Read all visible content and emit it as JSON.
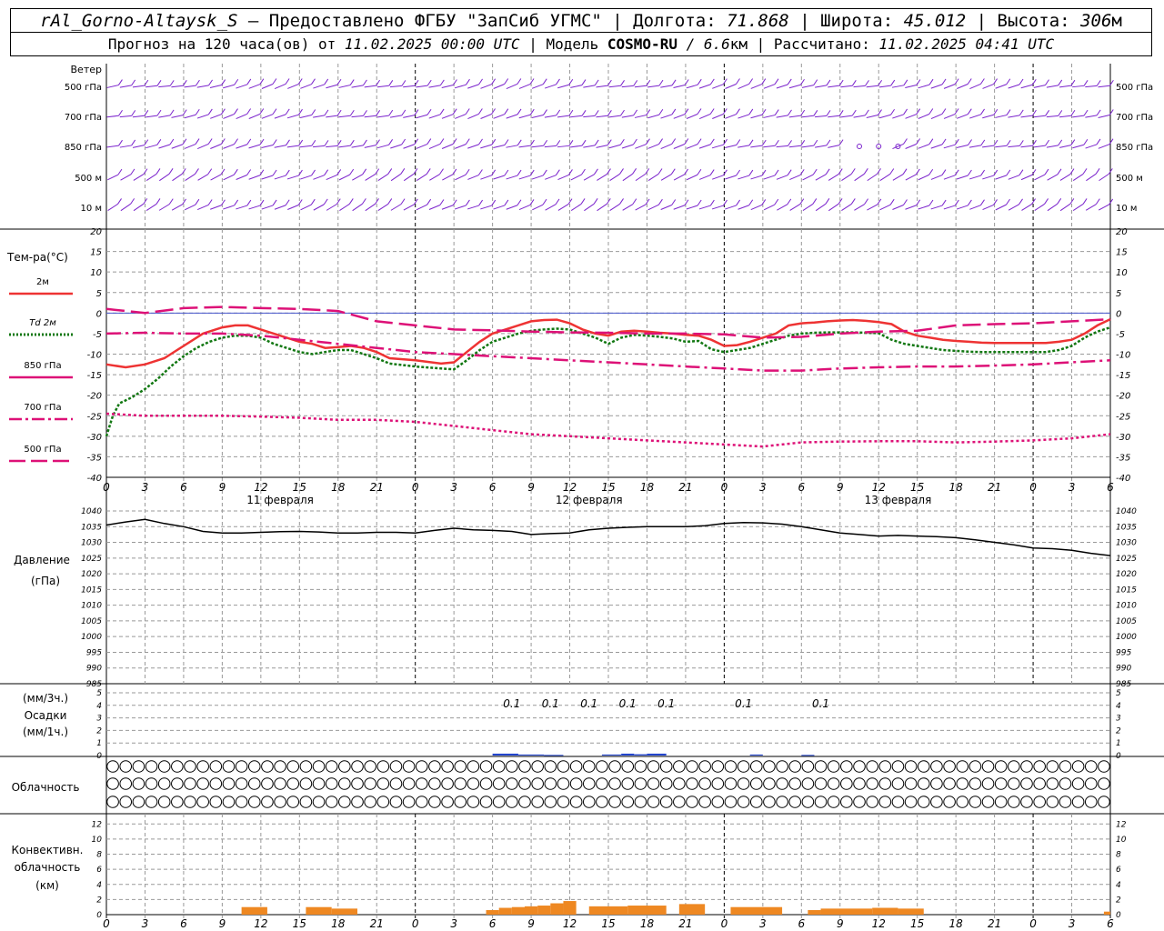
{
  "header": {
    "station": "rAl_Gorno-Altaysk_S",
    "provider": " — Предоставлено ФГБУ \"ЗапСиб УГМС\" | Долгота: ",
    "lon": "71.868",
    "lat_label": " | Широта: ",
    "lat": "45.012",
    "alt_label": " | Высота: ",
    "alt": "306",
    "alt_unit": "м",
    "forecast_label": "Прогноз на 120 часа(ов) от ",
    "forecast_from": "11.02.2025 00:00 UTC",
    "model_label": " | Модель ",
    "model": "COSMO-RU",
    "resolution": " / 6.6",
    "res_unit": "км",
    "calc_label": " | Рассчитано: ",
    "calc_time": "11.02.2025 04:41 UTC"
  },
  "labels": {
    "wind": "Ветер",
    "wind_levels": [
      "500 гПа",
      "700 гПа",
      "850 гПа",
      "500 м",
      "10 м"
    ],
    "temp_title": "Тем-ра(°С)",
    "temp_legend": [
      {
        "label": "2м",
        "color": "#ee3333",
        "style": "solid"
      },
      {
        "label": "Td 2м",
        "color": "#117711",
        "style": "dotted"
      },
      {
        "label": "850 гПа",
        "color": "#dd1177",
        "style": "solid"
      },
      {
        "label": "700 гПа",
        "color": "#dd1177",
        "style": "dashdot"
      },
      {
        "label": "500 гПа",
        "color": "#dd1177",
        "style": "dashed"
      }
    ],
    "pressure_title": "Давление",
    "pressure_unit": "(гПа)",
    "precip_unit3": "(мм/3ч.)",
    "precip_title": "Осадки",
    "precip_unit1": "(мм/1ч.)",
    "cloud_title": "Облачность",
    "conv_title1": "Конвективн.",
    "conv_title2": "облачность",
    "conv_unit": "(км)"
  },
  "colors": {
    "wind": "#7a22cc",
    "t2m": "#ee3333",
    "td2m": "#117711",
    "upper": "#dd1177",
    "zero_line": "#4455cc",
    "pressure": "#000000",
    "precip": "#2244cc",
    "conv": "#ee8822",
    "grid": "#999999"
  },
  "chart_data": {
    "type": "line",
    "x_hours": [
      0,
      3,
      6,
      9,
      12,
      15,
      18,
      21,
      24,
      27,
      30,
      33,
      36,
      39,
      42,
      45,
      48,
      51,
      54,
      57,
      60,
      63,
      66,
      69,
      72,
      75,
      78
    ],
    "x_tick_labels": [
      "0",
      "3",
      "6",
      "9",
      "12",
      "15",
      "18",
      "21",
      "0",
      "3",
      "6",
      "9",
      "12",
      "15",
      "18",
      "21",
      "0",
      "3",
      "6",
      "9",
      "12",
      "15",
      "18",
      "21",
      "0",
      "3",
      "6"
    ],
    "date_labels": [
      {
        "hour": 13.5,
        "text": "11 февраля"
      },
      {
        "hour": 37.5,
        "text": "12 февраля"
      },
      {
        "hour": 61.5,
        "text": "13 февраля"
      }
    ],
    "day_boundaries": [
      24,
      48,
      72
    ],
    "temperature": {
      "ylim": [
        -40,
        20
      ],
      "yticks": [
        20,
        15,
        10,
        5,
        0,
        -5,
        -10,
        -15,
        -20,
        -25,
        -30,
        -35,
        -40
      ],
      "series": [
        {
          "name": "2м",
          "x": [
            0,
            1.5,
            3,
            4.5,
            6,
            7.5,
            9,
            10,
            11,
            12,
            13,
            14,
            15,
            16,
            17,
            18,
            19,
            20,
            21,
            22,
            24,
            26,
            27,
            28,
            29,
            30,
            31,
            32,
            33,
            34,
            35,
            36,
            37,
            38,
            39,
            40,
            41,
            42,
            43,
            44,
            45,
            46,
            47,
            48,
            49,
            50,
            51,
            52,
            53,
            54,
            55,
            56,
            57,
            58,
            59,
            60,
            61,
            62,
            63,
            64,
            65,
            66,
            67,
            68,
            69,
            70,
            71,
            72,
            73,
            74,
            75,
            76,
            77,
            78
          ],
          "y": [
            -12.5,
            -13.2,
            -12.5,
            -11,
            -8,
            -5,
            -3.5,
            -3,
            -3,
            -4,
            -5,
            -6,
            -7,
            -7.5,
            -8.5,
            -8.3,
            -8,
            -8.5,
            -9.5,
            -11,
            -11.5,
            -12.3,
            -12,
            -9.5,
            -7,
            -5,
            -4,
            -3,
            -2,
            -1.7,
            -1.6,
            -2.5,
            -4,
            -5,
            -5.5,
            -4.5,
            -4.3,
            -4.5,
            -4.8,
            -5,
            -5.3,
            -5.5,
            -6.5,
            -8,
            -7.8,
            -7,
            -6,
            -5,
            -3,
            -2.5,
            -2.3,
            -2,
            -1.8,
            -1.7,
            -1.9,
            -2.2,
            -2.7,
            -4.5,
            -5.5,
            -6,
            -6.5,
            -6.8,
            -7,
            -7.2,
            -7.3,
            -7.3,
            -7.3,
            -7.3,
            -7.3,
            -7,
            -6.5,
            -5,
            -3,
            -1.5
          ]
        },
        {
          "name": "Td 2м",
          "x": [
            0,
            0.5,
            1,
            2,
            3,
            4,
            5,
            6,
            7,
            8,
            9,
            10,
            11,
            12,
            13,
            14,
            15,
            16,
            17,
            18,
            19,
            20,
            21,
            22,
            24,
            26,
            27,
            28,
            29,
            30,
            31,
            32,
            33,
            34,
            35,
            36,
            37,
            38,
            39,
            40,
            41,
            42,
            43,
            44,
            45,
            46,
            47,
            48,
            49,
            50,
            51,
            52,
            53,
            54,
            55,
            56,
            57,
            58,
            59,
            60,
            61,
            62,
            63,
            64,
            65,
            66,
            67,
            68,
            69,
            70,
            71,
            72,
            73,
            74,
            75,
            76,
            77,
            78
          ],
          "y": [
            -30,
            -25,
            -22,
            -20.5,
            -18.5,
            -16,
            -13,
            -10.5,
            -8.5,
            -7,
            -6,
            -5.5,
            -5.5,
            -6,
            -7.5,
            -8.5,
            -9.5,
            -10,
            -9.5,
            -9,
            -9,
            -10,
            -11,
            -12.3,
            -13,
            -13.5,
            -13.7,
            -11.5,
            -9,
            -7,
            -6,
            -5,
            -4.3,
            -4,
            -3.8,
            -4,
            -5,
            -6,
            -7.5,
            -6,
            -5.3,
            -5.5,
            -5.8,
            -6.2,
            -7,
            -6.8,
            -8.8,
            -9.5,
            -9,
            -8.5,
            -7.5,
            -6.5,
            -5.5,
            -5,
            -4.8,
            -4.7,
            -4.7,
            -4.7,
            -4.8,
            -4.9,
            -6.5,
            -7.5,
            -8,
            -8.5,
            -9,
            -9.2,
            -9.4,
            -9.5,
            -9.5,
            -9.5,
            -9.5,
            -9.5,
            -9.5,
            -9,
            -8,
            -6,
            -4.5,
            -3.5
          ]
        },
        {
          "name": "850 гПа",
          "x": [
            0,
            3,
            6,
            9,
            12,
            15,
            18,
            21,
            24,
            27,
            30,
            33,
            36,
            39,
            42,
            45,
            48,
            51,
            54,
            57,
            60,
            63,
            66,
            69,
            72,
            75,
            78
          ],
          "y": [
            1,
            0,
            1.2,
            1.5,
            1.2,
            1,
            0.5,
            -2,
            -3,
            -4,
            -4.2,
            -4.5,
            -4.7,
            -4.8,
            -5,
            -5,
            -5.2,
            -6,
            -5.8,
            -5,
            -4.5,
            -4.3,
            -3,
            -2.7,
            -2.5,
            -2,
            -1.5
          ]
        },
        {
          "name": "700 гПа",
          "x": [
            0,
            3,
            6,
            9,
            12,
            15,
            18,
            21,
            24,
            27,
            30,
            33,
            36,
            39,
            42,
            45,
            48,
            51,
            54,
            57,
            60,
            63,
            66,
            69,
            72,
            75,
            78
          ],
          "y": [
            -5,
            -4.8,
            -5,
            -5,
            -5.5,
            -6.5,
            -7.5,
            -8.5,
            -9.5,
            -10,
            -10.5,
            -11,
            -11.5,
            -12,
            -12.5,
            -13,
            -13.5,
            -14,
            -14,
            -13.5,
            -13.2,
            -13,
            -13,
            -12.8,
            -12.5,
            -12,
            -11.5
          ]
        },
        {
          "name": "500 гПа",
          "x": [
            0,
            3,
            6,
            9,
            12,
            15,
            18,
            21,
            24,
            27,
            30,
            33,
            36,
            39,
            42,
            45,
            48,
            51,
            54,
            57,
            60,
            63,
            66,
            69,
            72,
            75,
            78
          ],
          "y": [
            -24.5,
            -25,
            -25,
            -25,
            -25.2,
            -25.5,
            -26,
            -26,
            -26.5,
            -27.5,
            -28.5,
            -29.5,
            -30,
            -30.5,
            -31,
            -31.5,
            -32,
            -32.5,
            -31.5,
            -31.3,
            -31.2,
            -31.2,
            -31.5,
            -31.3,
            -31,
            -30.5,
            -29.5
          ]
        }
      ]
    },
    "pressure": {
      "ylim": [
        985,
        1040
      ],
      "yticks": [
        1040,
        1035,
        1030,
        1025,
        1020,
        1015,
        1010,
        1005,
        1000,
        995,
        990,
        985
      ],
      "series": [
        {
          "name": "Давление",
          "x": [
            0,
            1.5,
            3,
            4.5,
            6,
            7.5,
            9,
            10.5,
            12,
            13.5,
            15,
            16.5,
            18,
            19.5,
            21,
            22.5,
            24,
            25.5,
            27,
            28.5,
            30,
            31.5,
            33,
            34.5,
            36,
            37.5,
            39,
            40.5,
            42,
            43.5,
            45,
            46.5,
            48,
            49.5,
            51,
            52.5,
            54,
            55.5,
            57,
            58.5,
            60,
            61.5,
            63,
            64.5,
            66,
            67.5,
            69,
            70.5,
            72,
            73.5,
            75,
            76.5,
            78
          ],
          "y": [
            1035.5,
            1036.5,
            1037.3,
            1036,
            1035,
            1033.5,
            1033,
            1033,
            1033.2,
            1033.4,
            1033.5,
            1033.3,
            1033,
            1033,
            1033.2,
            1033.2,
            1033,
            1033.8,
            1034.5,
            1034,
            1033.8,
            1033.5,
            1032.5,
            1032.8,
            1033,
            1034,
            1034.5,
            1034.8,
            1035,
            1035,
            1035,
            1035.3,
            1036,
            1036.3,
            1036.2,
            1035.8,
            1035,
            1034,
            1033,
            1032.5,
            1032,
            1032.2,
            1032,
            1031.8,
            1031.5,
            1030.8,
            1030,
            1029.2,
            1028.2,
            1028,
            1027.5,
            1026.5,
            1025.8
          ]
        }
      ]
    },
    "precip": {
      "ylim": [
        0,
        5
      ],
      "yticks": [
        5,
        4,
        3,
        2,
        1,
        0
      ],
      "labels": [
        {
          "hour": 31.5,
          "text": "0.1"
        },
        {
          "hour": 34.5,
          "text": "0.1"
        },
        {
          "hour": 37.5,
          "text": "0.1"
        },
        {
          "hour": 40.5,
          "text": "0.1"
        },
        {
          "hour": 43.5,
          "text": "0.1"
        },
        {
          "hour": 49.5,
          "text": "0.1"
        },
        {
          "hour": 55.5,
          "text": "0.1"
        }
      ],
      "bars": [
        {
          "from": 30,
          "to": 32,
          "mm": 0.15
        },
        {
          "from": 32,
          "to": 34,
          "mm": 0.08
        },
        {
          "from": 34,
          "to": 35.5,
          "mm": 0.05
        },
        {
          "from": 38.5,
          "to": 40,
          "mm": 0.08
        },
        {
          "from": 40,
          "to": 41,
          "mm": 0.15
        },
        {
          "from": 41,
          "to": 42,
          "mm": 0.1
        },
        {
          "from": 42,
          "to": 43.5,
          "mm": 0.15
        },
        {
          "from": 50,
          "to": 51,
          "mm": 0.08
        },
        {
          "from": 54,
          "to": 55,
          "mm": 0.05
        }
      ]
    },
    "cloudiness": {
      "hours_per_symbol": 1,
      "legend": "0=clear,1=quarter,2=half,3=three-quarter,4=overcast",
      "rows": [
        "000000000000000000000000000000000000000000000000000000000000000000000000000000",
        "000000000000000000000000000000000000000000000000000000000000000000000000000000",
        "000000000000000000000000000000000000000000000000000000000000000000000000000000"
      ]
    },
    "convective": {
      "ylim": [
        0,
        13
      ],
      "yticks": [
        12,
        10,
        8,
        6,
        4,
        2,
        0
      ],
      "bars": [
        {
          "from": 10.5,
          "to": 12.5,
          "km": 1.0
        },
        {
          "from": 15.5,
          "to": 17.5,
          "km": 1.0
        },
        {
          "from": 17.5,
          "to": 19.5,
          "km": 0.8
        },
        {
          "from": 29.5,
          "to": 30.5,
          "km": 0.6
        },
        {
          "from": 30.5,
          "to": 31.5,
          "km": 0.9
        },
        {
          "from": 31.5,
          "to": 32.5,
          "km": 1.0
        },
        {
          "from": 32.5,
          "to": 33.5,
          "km": 1.1
        },
        {
          "from": 33.5,
          "to": 34.5,
          "km": 1.2
        },
        {
          "from": 34.5,
          "to": 35.5,
          "km": 1.5
        },
        {
          "from": 35.5,
          "to": 36.5,
          "km": 1.8
        },
        {
          "from": 37.5,
          "to": 40.5,
          "km": 1.1
        },
        {
          "from": 40.5,
          "to": 43.5,
          "km": 1.2
        },
        {
          "from": 44.5,
          "to": 46.5,
          "km": 1.4
        },
        {
          "from": 48.5,
          "to": 52.5,
          "km": 1.0
        },
        {
          "from": 54.5,
          "to": 55.5,
          "km": 0.6
        },
        {
          "from": 55.5,
          "to": 59.5,
          "km": 0.8
        },
        {
          "from": 59.5,
          "to": 61.5,
          "km": 0.9
        },
        {
          "from": 61.5,
          "to": 63.5,
          "km": 0.8
        },
        {
          "from": 77.5,
          "to": 78,
          "km": 0.4
        }
      ]
    }
  }
}
